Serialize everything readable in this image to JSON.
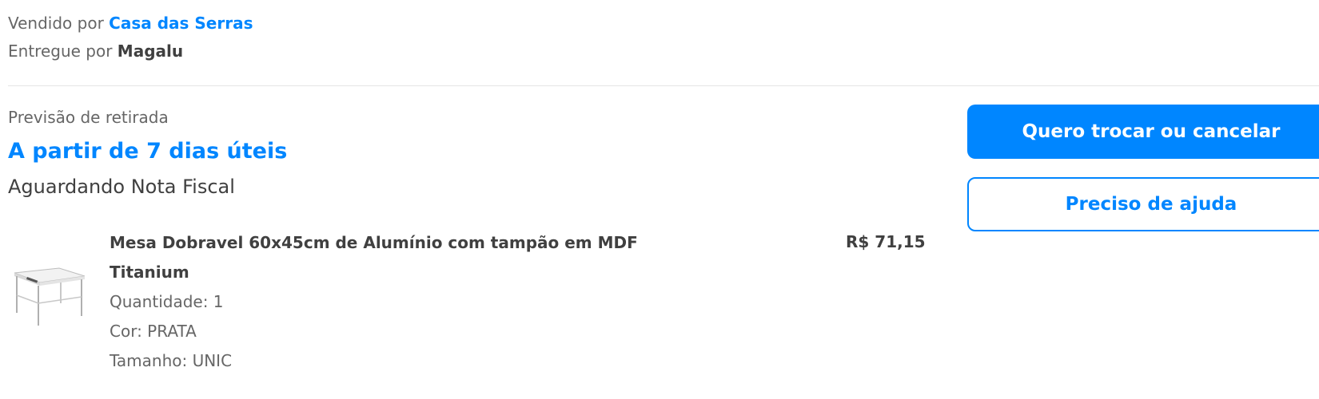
{
  "seller": {
    "prefix": "Vendido por",
    "name": "Casa das Serras"
  },
  "delivery": {
    "prefix": "Entregue por",
    "carrier": "Magalu"
  },
  "pickup": {
    "label": "Previsão de retirada",
    "value": "A partir de 7 dias úteis",
    "status": "Aguardando Nota Fiscal"
  },
  "product": {
    "name": "Mesa Dobravel 60x45cm de Alumínio com tampão em MDF Titanium",
    "price": "R$ 71,15",
    "quantity": "Quantidade: 1",
    "color": "Cor: PRATA",
    "size": "Tamanho: UNIC"
  },
  "actions": {
    "exchange_cancel": "Quero trocar ou cancelar",
    "help": "Preciso de ajuda"
  }
}
